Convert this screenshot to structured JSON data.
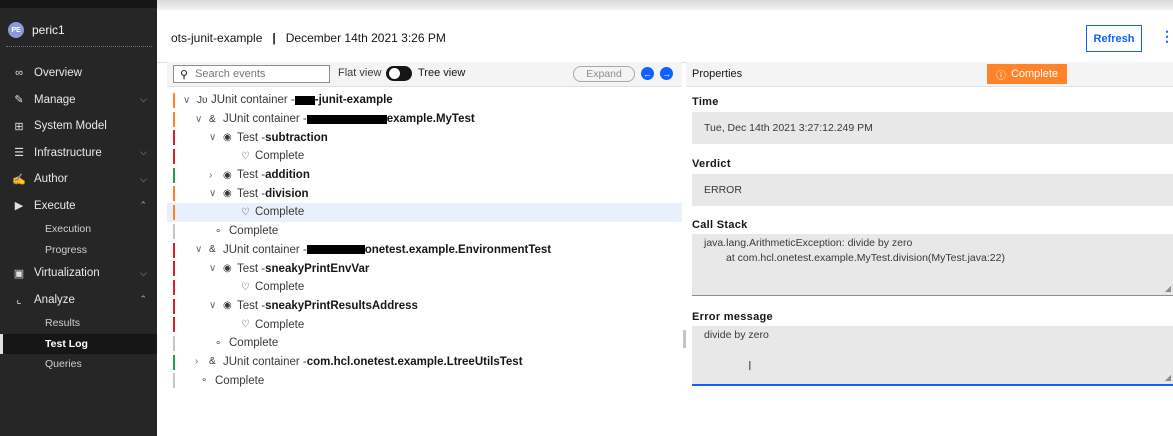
{
  "user": {
    "initials": "PE",
    "name": "peric1"
  },
  "nav": {
    "overview": "Overview",
    "manage": "Manage",
    "system_model": "System Model",
    "infrastructure": "Infrastructure",
    "author": "Author",
    "execute": "Execute",
    "execution": "Execution",
    "progress": "Progress",
    "virtualization": "Virtualization",
    "analyze": "Analyze",
    "results": "Results",
    "test_log": "Test Log",
    "queries": "Queries"
  },
  "header": {
    "project": "ots-junit-example",
    "separator": "|",
    "date": "December 14th 2021 3:26 PM",
    "refresh": "Refresh"
  },
  "events_toolbar": {
    "search_placeholder": "Search events",
    "flat_view": "Flat view",
    "tree_view": "Tree view",
    "expand": "Expand"
  },
  "tree": {
    "r1": {
      "prefix": "JUnit container - ",
      "name": "-junit-example"
    },
    "r2": {
      "prefix": "JUnit container - ",
      "name": "example.MyTest"
    },
    "r3": {
      "prefix": "Test - ",
      "name": "subtraction"
    },
    "r4": "Complete",
    "r5": {
      "prefix": "Test - ",
      "name": "addition"
    },
    "r6": {
      "prefix": "Test - ",
      "name": "division"
    },
    "r7": "Complete",
    "r8": "Complete",
    "r9": {
      "prefix": "JUnit container - ",
      "name": "onetest.example.EnvironmentTest"
    },
    "r10": {
      "prefix": "Test - ",
      "name": "sneakyPrintEnvVar"
    },
    "r11": "Complete",
    "r12": {
      "prefix": "Test - ",
      "name": "sneakyPrintResultsAddress"
    },
    "r13": "Complete",
    "r14": "Complete",
    "r15": {
      "prefix": "JUnit container - ",
      "name": "com.hcl.onetest.example.LtreeUtilsTest"
    },
    "r16": "Complete"
  },
  "properties": {
    "title": "Properties",
    "status": "Complete",
    "time_label": "Time",
    "time_value": "Tue, Dec 14th 2021 3:27:12.249 PM",
    "verdict_label": "Verdict",
    "verdict_value": "ERROR",
    "callstack_label": "Call Stack",
    "callstack_line1": "java.lang.ArithmeticException: divide by zero",
    "callstack_line2": "at com.hcl.onetest.example.MyTest.division(MyTest.java:22)",
    "error_label": "Error message",
    "error_value": "divide by zero"
  },
  "colors": {
    "verdict_pass": "#24a148",
    "verdict_error": "#da1e28",
    "verdict_warn": "#ff832b",
    "accent": "#0f62fe"
  },
  "icons": {
    "tree_expanded": "chevron-down-icon",
    "tree_collapsed": "chevron-right-icon",
    "junit": "junit-icon",
    "container": "container-icon",
    "test": "test-icon",
    "complete": "complete-icon"
  }
}
